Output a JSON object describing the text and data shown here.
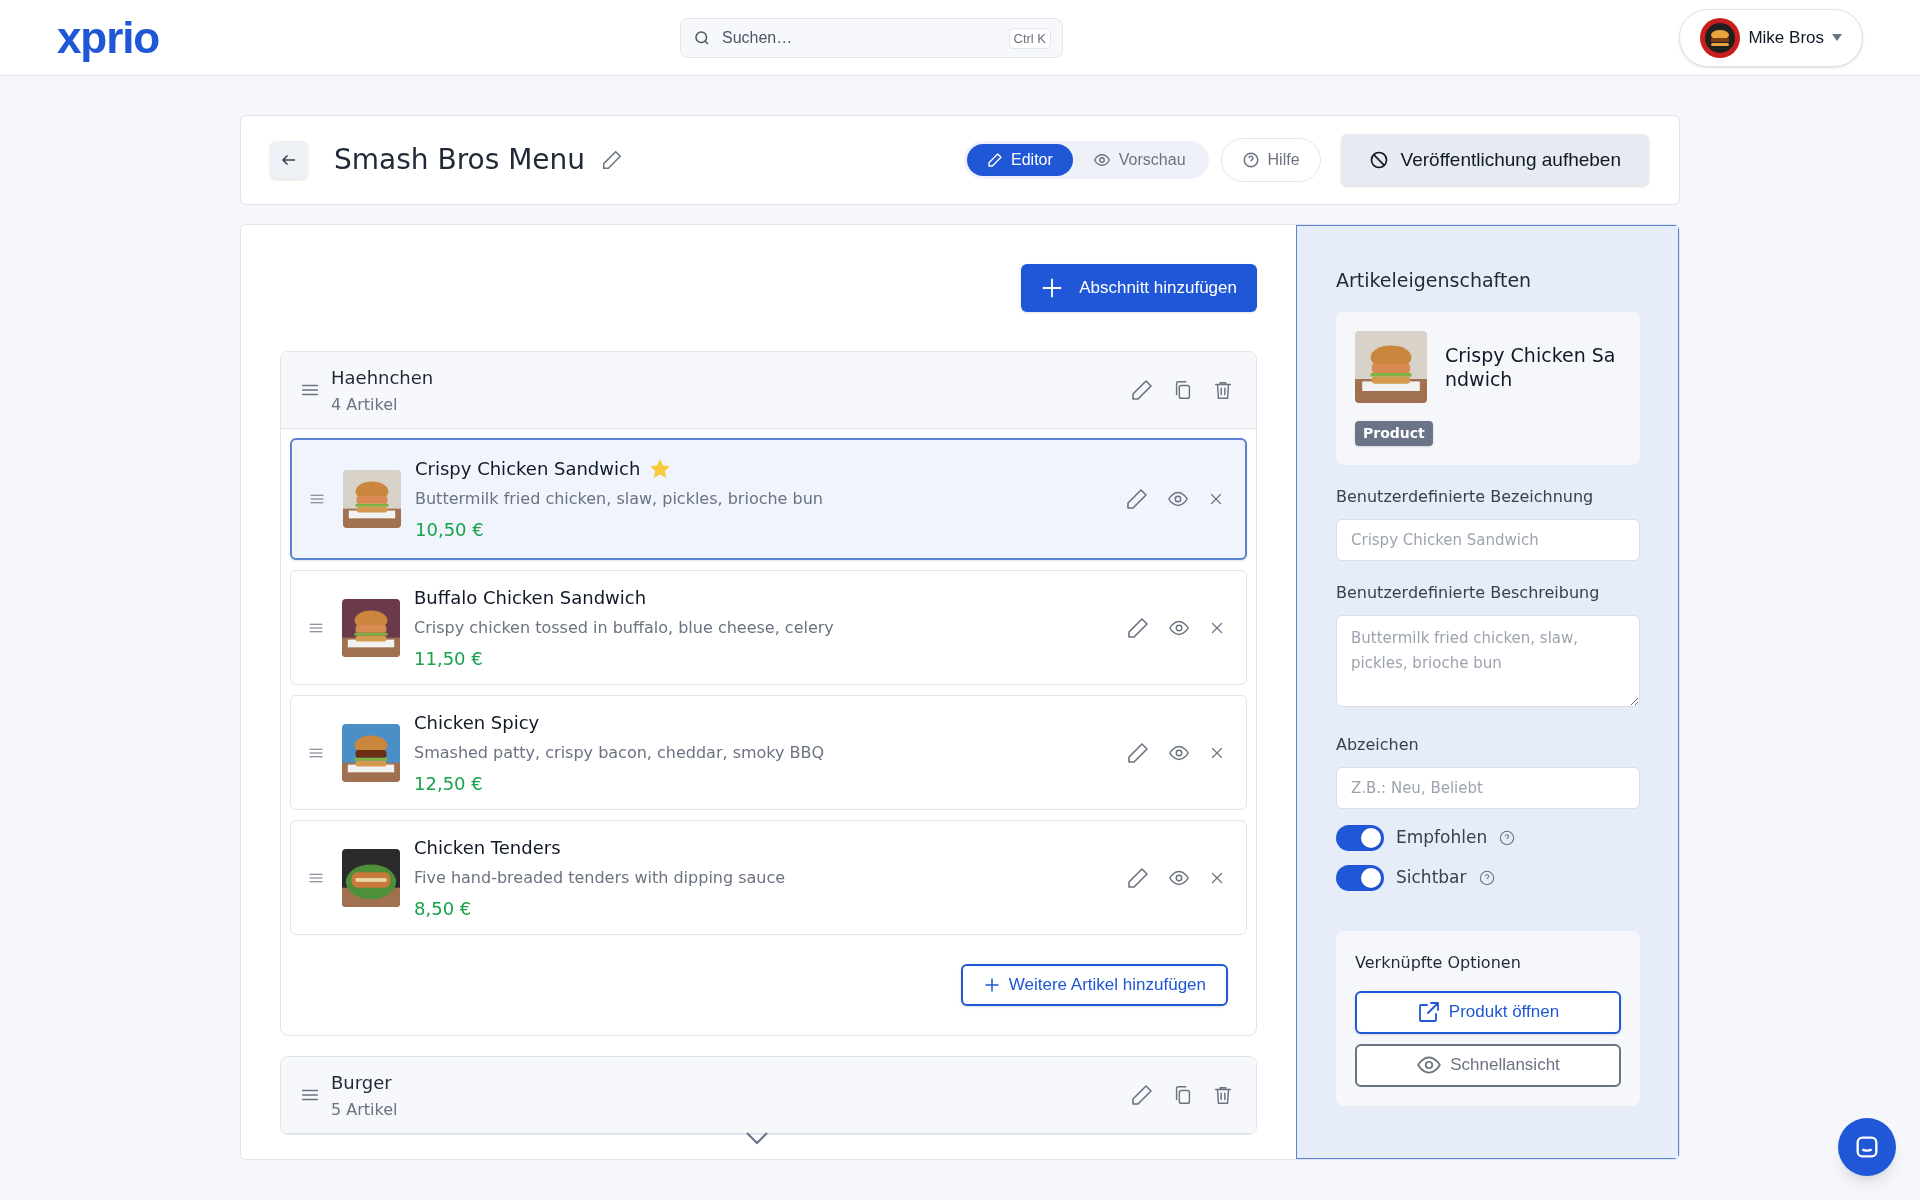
{
  "header": {
    "logo": "xprio",
    "search": {
      "placeholder": "Suchen…",
      "shortcut": "Ctrl K"
    },
    "user": {
      "name": "Mike Bros"
    }
  },
  "toolbar": {
    "title": "Smash Bros Menu",
    "modes": [
      {
        "label": "Editor",
        "selected": true
      },
      {
        "label": "Vorschau",
        "selected": false
      }
    ],
    "help": "Hilfe",
    "unpublish": "Veröffentlichung aufheben"
  },
  "editor": {
    "add_section": "Abschnitt hinzufügen",
    "sections": [
      {
        "name": "Haehnchen",
        "count": "4 Artikel",
        "add_more": "Weitere Artikel hinzufügen",
        "items": [
          {
            "name": "Crispy Chicken Sandwich",
            "description": "Buttermilk fried chicken, slaw, pickles, brioche bun",
            "price": "10,50 €",
            "featured": true,
            "selected": true
          },
          {
            "name": "Buffalo Chicken Sandwich",
            "description": "Crispy chicken tossed in buffalo, blue cheese, celery",
            "price": "11,50 €",
            "featured": false,
            "selected": false
          },
          {
            "name": "Chicken Spicy",
            "description": "Smashed patty, crispy bacon, cheddar, smoky BBQ",
            "price": "12,50 €",
            "featured": false,
            "selected": false
          },
          {
            "name": "Chicken Tenders",
            "description": "Five hand-breaded tenders with dipping sauce",
            "price": "8,50 €",
            "featured": false,
            "selected": false
          }
        ]
      },
      {
        "name": "Burger",
        "count": "5 Artikel"
      }
    ]
  },
  "properties": {
    "title": "Artikeleigenschaften",
    "product_name": "Crispy Chicken Sandwich",
    "product_tag": "Product",
    "fields": [
      {
        "label": "Benutzerdefinierte Bezeichnung",
        "placeholder": "Crispy Chicken Sandwich",
        "kind": "input"
      },
      {
        "label": "Benutzerdefinierte Beschreibung",
        "placeholder": "Buttermilk fried chicken, slaw, pickles, brioche bun",
        "kind": "textarea"
      },
      {
        "label": "Abzeichen",
        "placeholder": "Z.B.: Neu, Beliebt",
        "kind": "input"
      }
    ],
    "toggles": [
      {
        "label": "Empfohlen",
        "on": true
      },
      {
        "label": "Sichtbar",
        "on": true
      }
    ],
    "linked": {
      "title": "Verknüpfte Optionen",
      "buttons": [
        {
          "label": "Produkt öffnen",
          "kind": "primary"
        },
        {
          "label": "Schnellansicht",
          "kind": "secondary"
        }
      ]
    }
  }
}
